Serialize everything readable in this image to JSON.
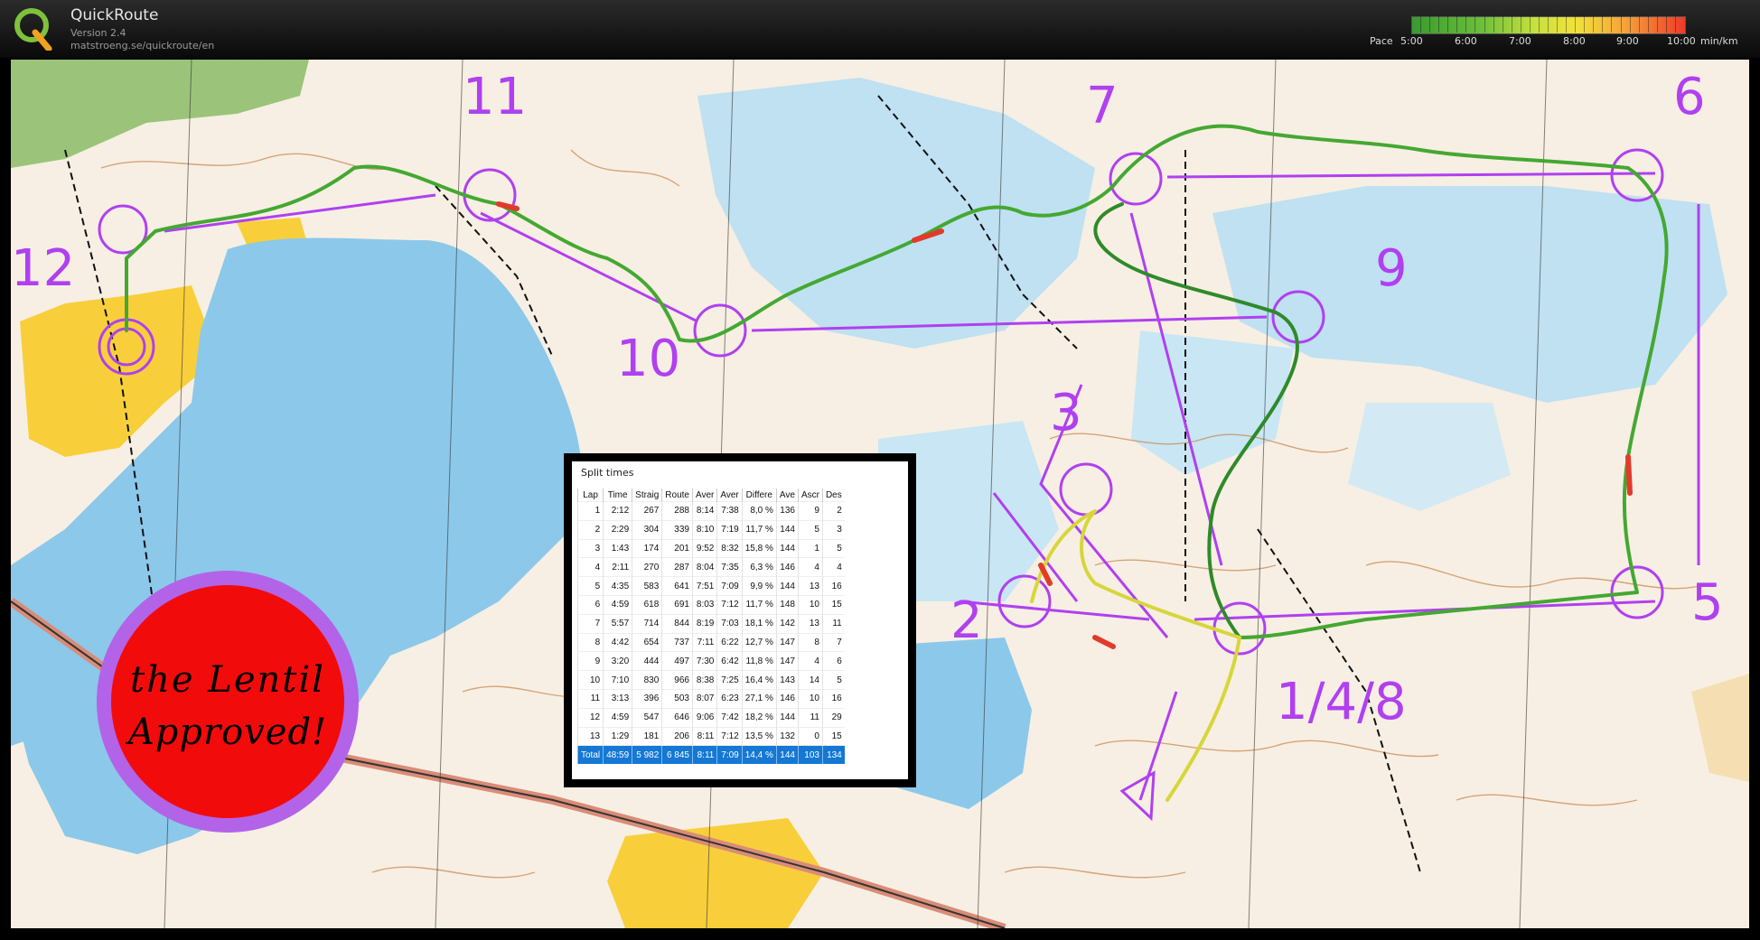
{
  "app": {
    "name": "QuickRoute",
    "version": "Version 2.4",
    "url": "matstroeng.se/quickroute/en"
  },
  "pace_legend": {
    "label": "Pace",
    "ticks": [
      "5:00",
      "6:00",
      "7:00",
      "8:00",
      "9:00",
      "10:00"
    ],
    "unit": "min/km",
    "colors": [
      "#3a9a30",
      "#6abf3a",
      "#c7e040",
      "#f2e23a",
      "#f5a33a",
      "#ee3a2a"
    ]
  },
  "map": {
    "controls": [
      "1/4/8",
      "2",
      "3",
      "5",
      "6",
      "7",
      "9",
      "10",
      "11",
      "12"
    ],
    "course_color": "#b040f0",
    "water_color": "#8cc8ea",
    "open_land_color": "#f8cf3a"
  },
  "split_times": {
    "title": "Split times",
    "columns": [
      "Lap",
      "Time",
      "Straig",
      "Route",
      "Aver",
      "Aver",
      "Differe",
      "Ave",
      "Ascr",
      "Des"
    ],
    "rows": [
      [
        "1",
        "2:12",
        "267",
        "288",
        "8:14",
        "7:38",
        "8,0 %",
        "136",
        "9",
        "2"
      ],
      [
        "2",
        "2:29",
        "304",
        "339",
        "8:10",
        "7:19",
        "11,7 %",
        "144",
        "5",
        "3"
      ],
      [
        "3",
        "1:43",
        "174",
        "201",
        "9:52",
        "8:32",
        "15,8 %",
        "144",
        "1",
        "5"
      ],
      [
        "4",
        "2:11",
        "270",
        "287",
        "8:04",
        "7:35",
        "6,3 %",
        "146",
        "4",
        "4"
      ],
      [
        "5",
        "4:35",
        "583",
        "641",
        "7:51",
        "7:09",
        "9,9 %",
        "144",
        "13",
        "16"
      ],
      [
        "6",
        "4:59",
        "618",
        "691",
        "8:03",
        "7:12",
        "11,7 %",
        "148",
        "10",
        "15"
      ],
      [
        "7",
        "5:57",
        "714",
        "844",
        "8:19",
        "7:03",
        "18,1 %",
        "142",
        "13",
        "11"
      ],
      [
        "8",
        "4:42",
        "654",
        "737",
        "7:11",
        "6:22",
        "12,7 %",
        "147",
        "8",
        "7"
      ],
      [
        "9",
        "3:20",
        "444",
        "497",
        "7:30",
        "6:42",
        "11,8 %",
        "147",
        "4",
        "6"
      ],
      [
        "10",
        "7:10",
        "830",
        "966",
        "8:38",
        "7:25",
        "16,4 %",
        "143",
        "14",
        "5"
      ],
      [
        "11",
        "3:13",
        "396",
        "503",
        "8:07",
        "6:23",
        "27,1 %",
        "146",
        "10",
        "16"
      ],
      [
        "12",
        "4:59",
        "547",
        "646",
        "9:06",
        "7:42",
        "18,2 %",
        "144",
        "11",
        "29"
      ],
      [
        "13",
        "1:29",
        "181",
        "206",
        "8:11",
        "7:12",
        "13,5 %",
        "132",
        "0",
        "15"
      ]
    ],
    "total": [
      "Total",
      "48:59",
      "5 982",
      "6 845",
      "8:11",
      "7:09",
      "14,4 %",
      "144",
      "103",
      "134"
    ]
  },
  "sticker": {
    "line1": "the Lentil",
    "line2": "Approved!"
  }
}
